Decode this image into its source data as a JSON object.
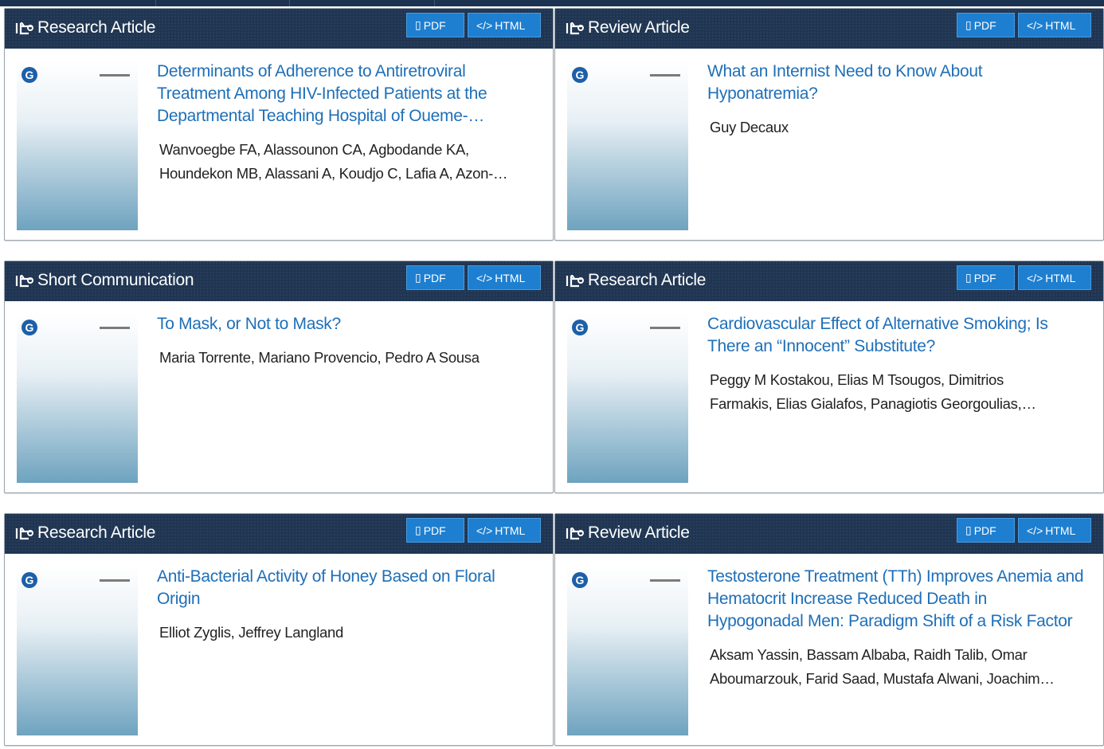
{
  "buttons": {
    "pdf": "PDF",
    "html": "HTML"
  },
  "cards": [
    {
      "type": "Research Article",
      "title": "Determinants of Adherence to Antiretroviral Treatment Among HIV-Infected Patients at the Departmental Teaching Hospital of Oueme-Plateau",
      "authors": "Wanvoegbe FA, Alassounon CA, Agbodande KA, Houndekon MB, Alassani A, Koudjo C, Lafia A, Azon-Kouanou A"
    },
    {
      "type": "Review Article",
      "title": "What an Internist Need to Know About Hyponatremia?",
      "authors": "Guy Decaux"
    },
    {
      "type": "Short Communication",
      "title": "To Mask, or Not to Mask?",
      "authors": "Maria Torrente, Mariano Provencio, Pedro A Sousa"
    },
    {
      "type": "Research Article",
      "title": "Cardiovascular Effect of Alternative Smoking; Is There an “Innocent” Substitute?",
      "authors": "Peggy M Kostakou, Elias M Tsougos, Dimitrios Farmakis, Elias Gialafos, Panagiotis Georgoulias, Nikolaos Kouris"
    },
    {
      "type": "Research Article",
      "title": "Anti-Bacterial Activity of Honey Based on Floral Origin",
      "authors": "Elliot Zyglis, Jeffrey Langland"
    },
    {
      "type": "Review Article",
      "title": "Testosterone Treatment (TTh) Improves Anemia and Hematocrit Increase Reduced Death in Hypogonadal Men: Paradigm Shift of a Risk Factor",
      "authors": "Aksam Yassin, Bassam Albaba, Raidh Talib, Omar Aboumarzouk, Farid Saad, Mustafa Alwani, Joachim Hoyer"
    }
  ]
}
